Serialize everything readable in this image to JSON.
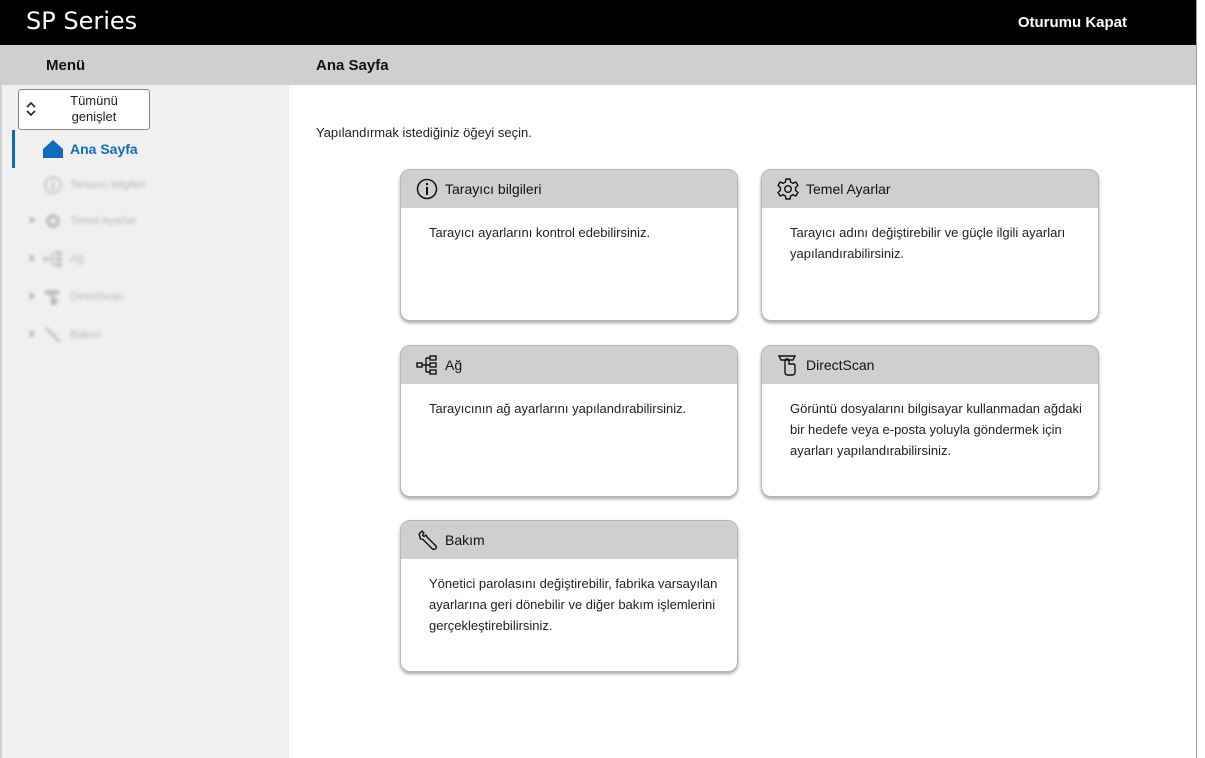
{
  "header": {
    "app_title": "SP Series",
    "logout_label": "Oturumu Kapat"
  },
  "subheader": {
    "menu_title": "Menü",
    "page_title": "Ana Sayfa"
  },
  "sidebar": {
    "expand_all_label": "Tümünü genişlet",
    "items": [
      {
        "label": "Ana Sayfa",
        "icon": "home-icon",
        "active": true
      },
      {
        "label": "Tarayıcı bilgileri",
        "icon": "info-icon"
      },
      {
        "label": "Temel Ayarlar",
        "icon": "gear-icon"
      },
      {
        "label": "Ağ",
        "icon": "network-icon"
      },
      {
        "label": "DirectScan",
        "icon": "directscan-icon"
      },
      {
        "label": "Bakım",
        "icon": "wrench-icon"
      }
    ]
  },
  "main": {
    "intro": "Yapılandırmak istediğiniz öğeyi seçin.",
    "cards": [
      {
        "title": "Tarayıcı bilgileri",
        "icon": "info-icon",
        "description": "Tarayıcı ayarlarını kontrol edebilirsiniz."
      },
      {
        "title": "Temel Ayarlar",
        "icon": "gear-icon",
        "description": "Tarayıcı adını değiştirebilir ve güçle ilgili ayarları yapılandırabilirsiniz."
      },
      {
        "title": "Ağ",
        "icon": "network-icon",
        "description": "Tarayıcının ağ ayarlarını yapılandırabilirsiniz."
      },
      {
        "title": "DirectScan",
        "icon": "directscan-icon",
        "description": "Görüntü dosyalarını bilgisayar kullanmadan ağdaki bir hedefe veya e-posta yoluyla göndermek için ayarları yapılandırabilirsiniz."
      },
      {
        "title": "Bakım",
        "icon": "wrench-icon",
        "description": "Yönetici parolasını değiştirebilir, fabrika varsayılan ayarlarına geri dönebilir ve diğer bakım işlemlerini gerçekleştirebilirsiniz."
      }
    ]
  },
  "colors": {
    "topbar": "#000000",
    "subbar": "#cfcfcf",
    "sidebar": "#f0f0f0",
    "accent": "#0f6cbd",
    "card_header": "#cfcfcf"
  }
}
